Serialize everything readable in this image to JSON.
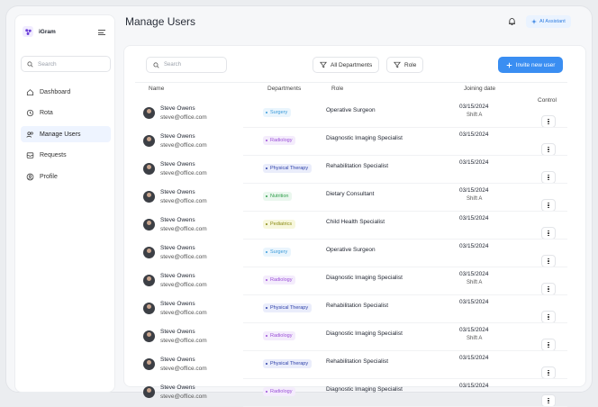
{
  "app": {
    "name": "iGram"
  },
  "sidebar": {
    "search_placeholder": "Search",
    "items": [
      {
        "label": "Dashboard",
        "icon": "home-icon",
        "active": false
      },
      {
        "label": "Rota",
        "icon": "clock-icon",
        "active": false
      },
      {
        "label": "Manage Users",
        "icon": "users-icon",
        "active": true
      },
      {
        "label": "Requests",
        "icon": "inbox-icon",
        "active": false
      },
      {
        "label": "Profile",
        "icon": "profile-icon",
        "active": false
      }
    ]
  },
  "header": {
    "title": "Manage Users",
    "ai_label": "AI Assistant"
  },
  "toolbar": {
    "search_placeholder": "Search",
    "departments_label": "All Departments",
    "role_label": "Role",
    "invite_label": "Invite new user"
  },
  "table": {
    "columns": {
      "name": "Name",
      "departments": "Departments",
      "role": "Role",
      "joining": "Joining date",
      "control": "Control"
    },
    "rows": [
      {
        "name": "Steve Owens",
        "email": "steve@office.com",
        "dept": "Surgery",
        "dept_color": "#3a9ad9",
        "dept_bg": "#eaf5fd",
        "role": "Operative Surgeon",
        "date": "03/15/2024",
        "shift": "Shift A"
      },
      {
        "name": "Steve Owens",
        "email": "steve@office.com",
        "dept": "Radiology",
        "dept_color": "#9b4fd8",
        "dept_bg": "#f4ecfc",
        "role": "Diagnostic Imaging Specialist",
        "date": "03/15/2024",
        "shift": ""
      },
      {
        "name": "Steve Owens",
        "email": "steve@office.com",
        "dept": "Physical Therapy",
        "dept_color": "#2c3fa8",
        "dept_bg": "#eaedfb",
        "role": "Rehabilitation Specialist",
        "date": "03/15/2024",
        "shift": ""
      },
      {
        "name": "Steve Owens",
        "email": "steve@office.com",
        "dept": "Nutrition",
        "dept_color": "#2f9e4a",
        "dept_bg": "#eaf7ee",
        "role": "Dietary Consultant",
        "date": "03/15/2024",
        "shift": "Shift A"
      },
      {
        "name": "Steve Owens",
        "email": "steve@office.com",
        "dept": "Pediatrics",
        "dept_color": "#8a8a12",
        "dept_bg": "#f7f7dc",
        "role": "Child Health Specialist",
        "date": "03/15/2024",
        "shift": ""
      },
      {
        "name": "Steve Owens",
        "email": "steve@office.com",
        "dept": "Surgery",
        "dept_color": "#3a9ad9",
        "dept_bg": "#eaf5fd",
        "role": "Operative Surgeon",
        "date": "03/15/2024",
        "shift": ""
      },
      {
        "name": "Steve Owens",
        "email": "steve@office.com",
        "dept": "Radiology",
        "dept_color": "#9b4fd8",
        "dept_bg": "#f4ecfc",
        "role": "Diagnostic Imaging Specialist",
        "date": "03/15/2024",
        "shift": "Shift A"
      },
      {
        "name": "Steve Owens",
        "email": "steve@office.com",
        "dept": "Physical Therapy",
        "dept_color": "#2c3fa8",
        "dept_bg": "#eaedfb",
        "role": "Rehabilitation Specialist",
        "date": "03/15/2024",
        "shift": ""
      },
      {
        "name": "Steve Owens",
        "email": "steve@office.com",
        "dept": "Radiology",
        "dept_color": "#9b4fd8",
        "dept_bg": "#f4ecfc",
        "role": "Diagnostic Imaging Specialist",
        "date": "03/15/2024",
        "shift": "Shift A"
      },
      {
        "name": "Steve Owens",
        "email": "steve@office.com",
        "dept": "Physical Therapy",
        "dept_color": "#2c3fa8",
        "dept_bg": "#eaedfb",
        "role": "Rehabilitation Specialist",
        "date": "03/15/2024",
        "shift": ""
      },
      {
        "name": "Steve Owens",
        "email": "steve@office.com",
        "dept": "Radiology",
        "dept_color": "#9b4fd8",
        "dept_bg": "#f4ecfc",
        "role": "Diagnostic Imaging Specialist",
        "date": "03/15/2024",
        "shift": ""
      }
    ]
  }
}
